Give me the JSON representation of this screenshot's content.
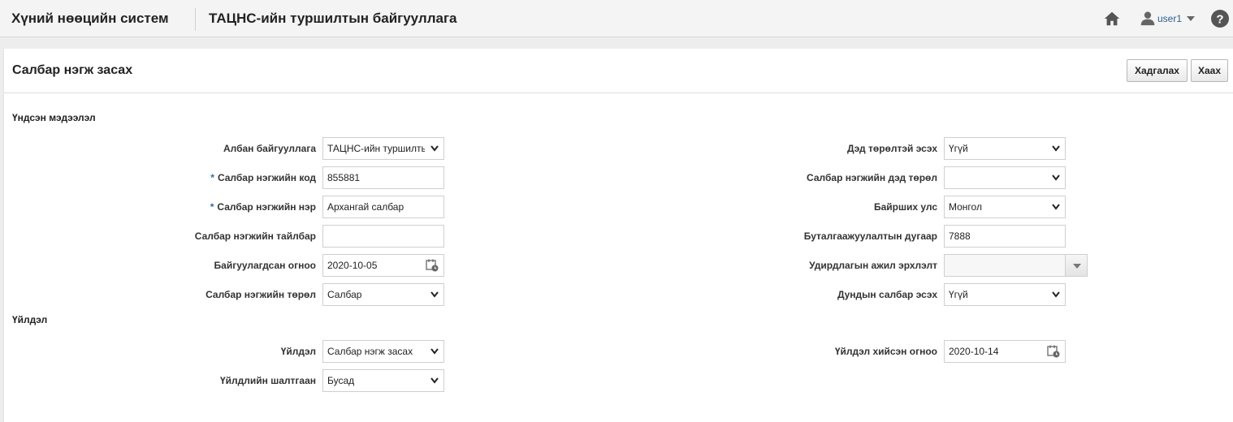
{
  "header": {
    "app_title": "Хүний нөөцийн систем",
    "org_title": "ТАЦНС-ийн туршилтын байгууллага",
    "user_name": "user1",
    "icons": [
      "home-icon",
      "user-icon",
      "chevron-down-icon",
      "help-icon"
    ]
  },
  "page": {
    "title": "Салбар нэгж засах",
    "save_label": "Хадгалах",
    "close_label": "Хаах"
  },
  "basic": {
    "section_title": "Үндсэн мэдээлэл",
    "org_label": "Албан байгууллага",
    "org_value": "ТАЦНС-ийн туршилты",
    "code_label": "Салбар нэгжийн код",
    "code_value": "855881",
    "name_label": "Салбар нэгжийн нэр",
    "name_value": "Архангай салбар",
    "desc_label": "Салбар нэгжийн тайлбар",
    "desc_value": "",
    "founded_label": "Байгуулагдсан огноо",
    "founded_value": "2020-10-05",
    "type_label": "Салбар нэгжийн төрөл",
    "type_value": "Салбар",
    "has_subtype_label": "Дэд төрөлтэй эсэх",
    "has_subtype_value": "Үгүй",
    "subtype_label": "Салбар нэгжийн дэд төрөл",
    "subtype_value": "",
    "country_label": "Байрших улс",
    "country_value": "Монгол",
    "accounting_label": "Буталгаажуулалтын дугаар",
    "accounting_value": "7888",
    "mgmt_position_label": "Удирдлагын ажил эрхлэлт",
    "mgmt_position_value": "",
    "intermediate_label": "Дундын салбар эсэх",
    "intermediate_value": "Үгүй"
  },
  "action": {
    "section_title": "Үйлдэл",
    "action_label": "Үйлдэл",
    "action_value": "Салбар нэгж засах",
    "reason_label": "Үйлдлийн шалтгаан",
    "reason_value": "Бусад",
    "date_label": "Үйлдэл хийсэн огноо",
    "date_value": "2020-10-14"
  },
  "required_marker": "*",
  "colors": {
    "link": "#2a5f8f",
    "required": "#2b6cb0",
    "border": "#cfcfcf"
  }
}
